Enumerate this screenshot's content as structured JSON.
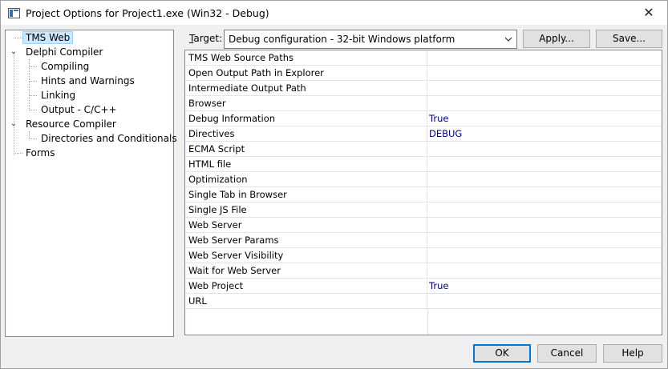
{
  "window": {
    "title": "Project Options for Project1.exe  (Win32 - Debug)",
    "close_glyph": "✕"
  },
  "tree": {
    "items": [
      {
        "label": "TMS Web",
        "selected": true
      },
      {
        "label": "Delphi Compiler",
        "expanded": true
      },
      {
        "label": "Compiling"
      },
      {
        "label": "Hints and Warnings"
      },
      {
        "label": "Linking"
      },
      {
        "label": "Output - C/C++"
      },
      {
        "label": "Resource Compiler",
        "expanded": true
      },
      {
        "label": "Directories and Conditionals"
      },
      {
        "label": "Forms"
      }
    ]
  },
  "target": {
    "label_prefix": "",
    "label_mnemonic": "T",
    "label_rest": "arget:",
    "value": "Debug configuration - 32-bit Windows platform"
  },
  "buttons": {
    "apply": "Apply...",
    "save": "Save...",
    "ok": "OK",
    "cancel": "Cancel",
    "help": "Help"
  },
  "properties": [
    {
      "name": "TMS Web Source Paths",
      "value": ""
    },
    {
      "name": "Open Output Path in Explorer",
      "value": ""
    },
    {
      "name": "Intermediate Output Path",
      "value": ""
    },
    {
      "name": "Browser",
      "value": ""
    },
    {
      "name": "Debug Information",
      "value": "True"
    },
    {
      "name": "Directives",
      "value": "DEBUG"
    },
    {
      "name": "ECMA Script",
      "value": ""
    },
    {
      "name": "HTML file",
      "value": ""
    },
    {
      "name": "Optimization",
      "value": ""
    },
    {
      "name": "Single Tab in Browser",
      "value": ""
    },
    {
      "name": "Single JS File",
      "value": ""
    },
    {
      "name": "Web Server",
      "value": ""
    },
    {
      "name": "Web Server Params",
      "value": ""
    },
    {
      "name": "Web Server Visibility",
      "value": ""
    },
    {
      "name": "Wait for Web Server",
      "value": ""
    },
    {
      "name": "Web Project",
      "value": "True"
    },
    {
      "name": "URL",
      "value": ""
    }
  ]
}
